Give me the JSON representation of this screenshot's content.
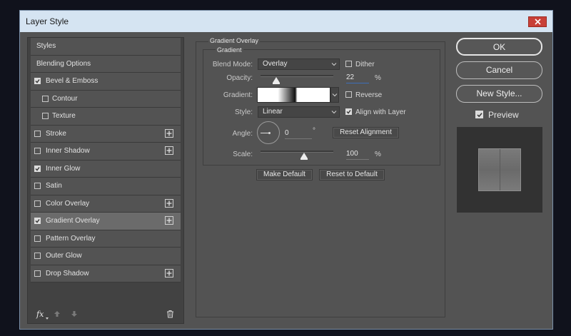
{
  "window": {
    "title": "Layer Style"
  },
  "styles_panel": {
    "items": [
      {
        "label": "Styles",
        "checkbox": false,
        "checked": false,
        "plus": false,
        "indent": 0,
        "selected": false
      },
      {
        "label": "Blending Options",
        "checkbox": false,
        "checked": false,
        "plus": false,
        "indent": 0,
        "selected": false
      },
      {
        "label": "Bevel & Emboss",
        "checkbox": true,
        "checked": true,
        "plus": false,
        "indent": 0,
        "selected": false
      },
      {
        "label": "Contour",
        "checkbox": true,
        "checked": false,
        "plus": false,
        "indent": 1,
        "selected": false
      },
      {
        "label": "Texture",
        "checkbox": true,
        "checked": false,
        "plus": false,
        "indent": 1,
        "selected": false
      },
      {
        "label": "Stroke",
        "checkbox": true,
        "checked": false,
        "plus": true,
        "indent": 0,
        "selected": false
      },
      {
        "label": "Inner Shadow",
        "checkbox": true,
        "checked": false,
        "plus": true,
        "indent": 0,
        "selected": false
      },
      {
        "label": "Inner Glow",
        "checkbox": true,
        "checked": true,
        "plus": false,
        "indent": 0,
        "selected": false
      },
      {
        "label": "Satin",
        "checkbox": true,
        "checked": false,
        "plus": false,
        "indent": 0,
        "selected": false
      },
      {
        "label": "Color Overlay",
        "checkbox": true,
        "checked": false,
        "plus": true,
        "indent": 0,
        "selected": false
      },
      {
        "label": "Gradient Overlay",
        "checkbox": true,
        "checked": true,
        "plus": true,
        "indent": 0,
        "selected": true
      },
      {
        "label": "Pattern Overlay",
        "checkbox": true,
        "checked": false,
        "plus": false,
        "indent": 0,
        "selected": false
      },
      {
        "label": "Outer Glow",
        "checkbox": true,
        "checked": false,
        "plus": false,
        "indent": 0,
        "selected": false
      },
      {
        "label": "Drop Shadow",
        "checkbox": true,
        "checked": false,
        "plus": true,
        "indent": 0,
        "selected": false
      }
    ],
    "footer": {
      "fx_label": "fx"
    }
  },
  "gradient_overlay": {
    "section_title": "Gradient Overlay",
    "group_title": "Gradient",
    "blend_mode": {
      "label": "Blend Mode:",
      "value": "Overlay"
    },
    "dither": {
      "label": "Dither",
      "checked": false
    },
    "opacity": {
      "label": "Opacity:",
      "value": "22",
      "unit": "%",
      "slider_fraction": 0.22
    },
    "gradient": {
      "label": "Gradient:"
    },
    "reverse": {
      "label": "Reverse",
      "checked": false
    },
    "style": {
      "label": "Style:",
      "value": "Linear"
    },
    "align_with_layer": {
      "label": "Align with Layer",
      "checked": true
    },
    "angle": {
      "label": "Angle:",
      "value": "0",
      "unit": "°"
    },
    "reset_alignment": "Reset Alignment",
    "scale": {
      "label": "Scale:",
      "value": "100",
      "unit": "%",
      "slider_fraction": 0.6
    },
    "make_default": "Make Default",
    "reset_to_default": "Reset to Default"
  },
  "actions": {
    "ok": "OK",
    "cancel": "Cancel",
    "new_style": "New Style...",
    "preview": {
      "label": "Preview",
      "checked": true
    }
  }
}
